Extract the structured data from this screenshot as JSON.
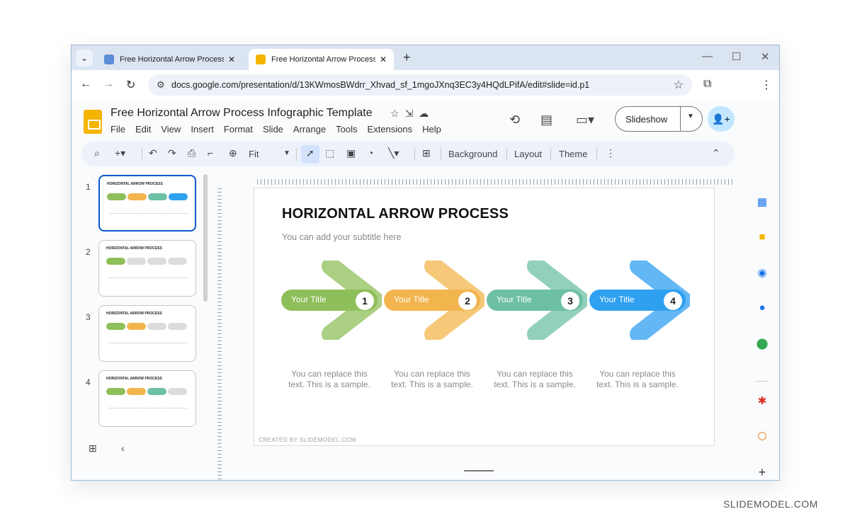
{
  "browser": {
    "tabs": [
      {
        "title": "Free Horizontal Arrow Process I",
        "active": false
      },
      {
        "title": "Free Horizontal Arrow Process I",
        "active": true
      }
    ],
    "url": "docs.google.com/presentation/d/13KWmosBWdrr_Xhvad_sf_1mgoJXnq3EC3y4HQdLPifA/edit#slide=id.p1",
    "icons": [
      "chevron-down-icon",
      "close-icon",
      "plus-icon",
      "minimize-icon",
      "maximize-icon",
      "back-icon",
      "forward-icon",
      "reload-icon",
      "tune-icon",
      "star-icon",
      "extensions-icon",
      "more-vert-icon"
    ]
  },
  "docs": {
    "title": "Free Horizontal Arrow Process Infographic Template",
    "menu": [
      "File",
      "Edit",
      "View",
      "Insert",
      "Format",
      "Slide",
      "Arrange",
      "Tools",
      "Extensions",
      "Help"
    ],
    "slideshow_label": "Slideshow",
    "toolbar": {
      "zoom": "Fit",
      "background": "Background",
      "layout": "Layout",
      "theme": "Theme"
    }
  },
  "filmstrip": {
    "slides": [
      {
        "number": "1",
        "title": "HORIZONTAL ARROW PROCESS",
        "selected": true,
        "colored": 4
      },
      {
        "number": "2",
        "title": "HORIZONTAL ARROW PROCESS",
        "selected": false,
        "colored": 1
      },
      {
        "number": "3",
        "title": "HORIZONTAL ARROW PROCESS",
        "selected": false,
        "colored": 2
      },
      {
        "number": "4",
        "title": "HORIZONTAL ARROW PROCESS",
        "selected": false,
        "colored": 3
      }
    ]
  },
  "slide": {
    "title": "HORIZONTAL ARROW PROCESS",
    "subtitle": "You can add your subtitle here",
    "steps": [
      {
        "title": "Your Title",
        "number": "1",
        "color": "#8fbf5a",
        "text": "You can replace this text. This is a sample."
      },
      {
        "title": "Your Title",
        "number": "2",
        "color": "#f2b54e",
        "text": "You can replace this text. This is a sample."
      },
      {
        "title": "Your Title",
        "number": "3",
        "color": "#6dbfa5",
        "text": "You can replace this text. This is a sample."
      },
      {
        "title": "Your Title",
        "number": "4",
        "color": "#2f9ff0",
        "text": "You can replace this text. This is a sample."
      }
    ],
    "credit": "CREATED BY SLIDEMODEL.COM"
  },
  "watermark": "SLIDEMODEL.COM"
}
